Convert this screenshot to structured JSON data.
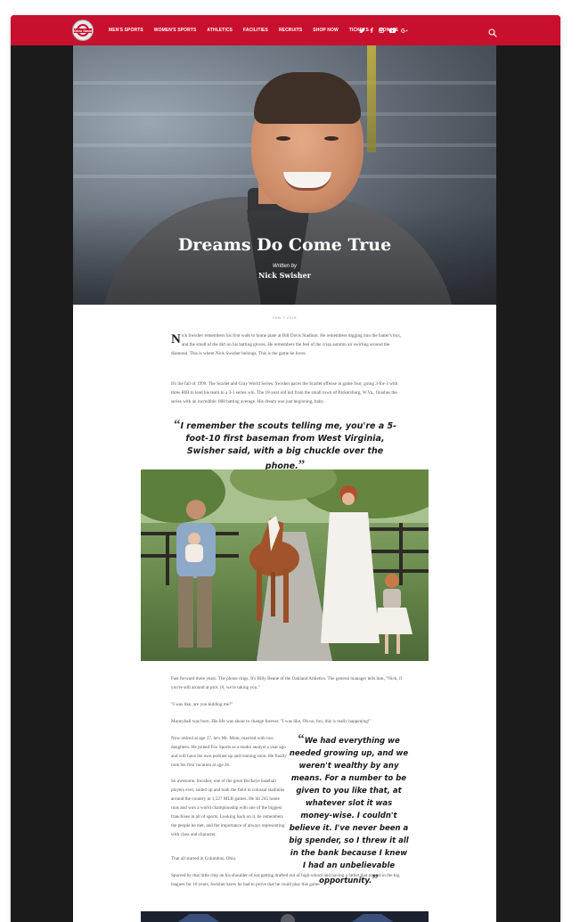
{
  "nav": {
    "items": [
      "Men's Sports",
      "Women's Sports",
      "Athletics",
      "Facilities",
      "Recruits",
      "Shop Now",
      "Tickets",
      "Donate"
    ],
    "logo_text": "Ohio State",
    "social": [
      "twitter-icon",
      "facebook-icon",
      "instagram-icon",
      "youtube-icon",
      "google-plus-icon"
    ]
  },
  "hero": {
    "title": "Dreams Do Come True",
    "by": "Written by",
    "author": "Nick Swisher"
  },
  "article": {
    "date": "FEB 7 2018",
    "dropcap": "N",
    "p1": "ick Swisher remembers his first walk to home plate at Bill Davis Stadium. He remembers digging into the batter's box, and the smell of the dirt on his batting gloves. He remembers the feel of the crisp autumn air swirling around the diamond. This is where Nick Swisher belongs. This is the game he loves.",
    "p2": "It's the fall of 1999. The Scarlet and Gray World Series. Swisher paces the Scarlet offense in game four, going 3-for-3 with three RBI to lead his team to a 3-1 series win. The 18-year old kid from the small town of Parkersburg, W.Va., finishes the series with an incredible .800 batting average. His dream was just beginning, baby.",
    "quote1": "I remember the scouts telling me, you're a 5-foot-10 first baseman from West Virginia, Swisher said, with a big chuckle over the phone.",
    "quote_open": "“",
    "quote_close": "”",
    "p3": "Fast forward three years. The phone rings. It's Billy Beane of the Oakland Athletics. The general manager tells him, \"Nick, if you're still around at pick 16, we're taking you.\"",
    "p4": "\"I was like, are you kidding me?\"",
    "p5": "Moneyball was born. His life was about to change forever. \"I was like, Oh no, bro, this is really happening!\"",
    "c1": "Now retired at age 37, he's Mr. Mom, married with two daughters. He joined Fox Sports as a studio analyst a year ago and will have his own podcast up and running soon. He finally took his first vacation at age 36.",
    "c2": "So awesome. Swisher, one of the great Buckeye baseball players ever, suited up and took the field in colossal stadiums around the country in 1,527 MLB games. He hit 245 home runs and won a world championship with one of the biggest franchises in all of sports. Looking back on it, he remembers the people he met, and the importance of always representing with class and character.",
    "c3": "That all started in Columbus, Ohio.",
    "p6": "Spurred by that little chip on his shoulder of not getting drafted out of high school and having a father that played in the big leagues for 10 years, Swisher knew he had to prove that he could play this game.",
    "quote2": "We had everything we needed growing up, and we weren't wealthy by any means. For a number to be given to you like that, at whatever slot it was money-wise. I couldn't believe it. I've never been a big spender, so I threw it all in the bank because I knew I had an unbelievable opportunity."
  }
}
